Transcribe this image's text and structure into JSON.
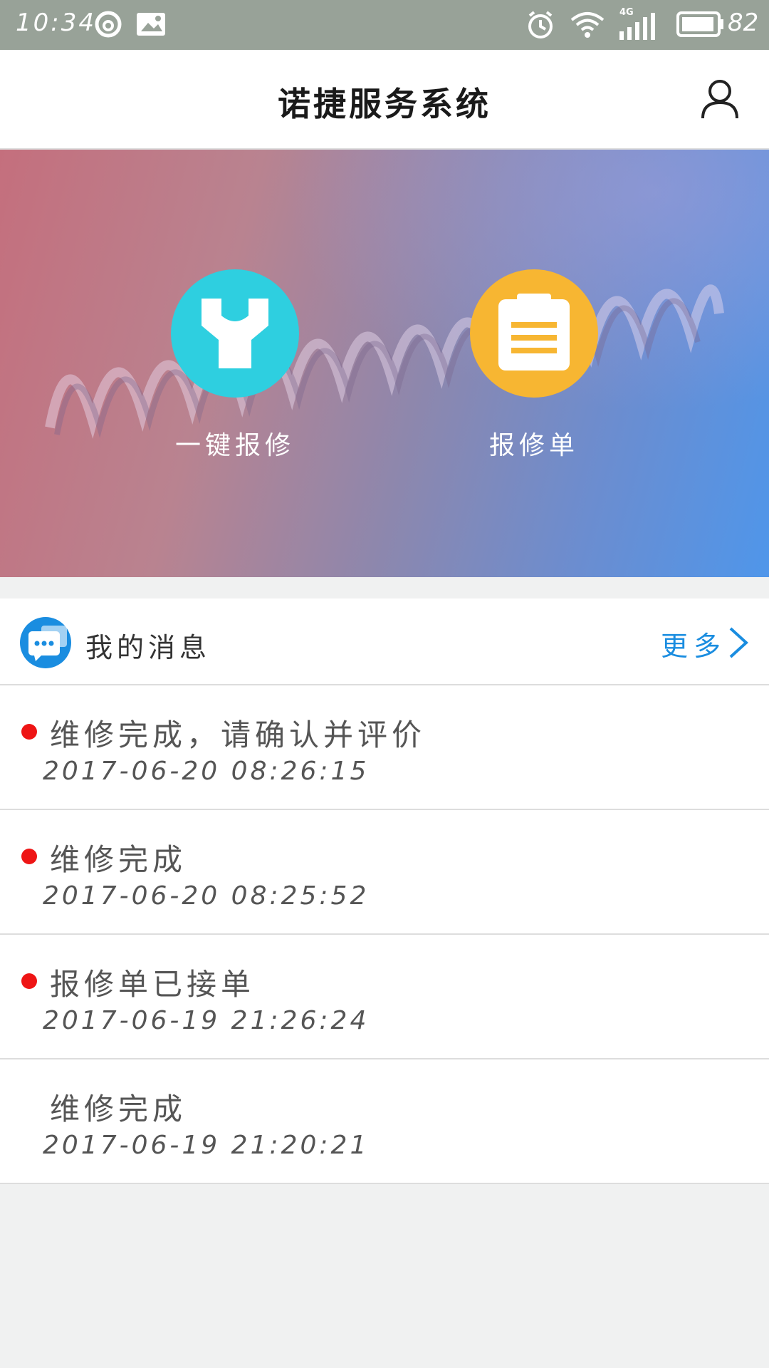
{
  "status_bar": {
    "time": "10:34",
    "network": "4G",
    "battery": "82",
    "icons": [
      "netease-icon",
      "image-icon",
      "alarm-icon",
      "wifi-icon",
      "signal-icon",
      "battery-icon"
    ]
  },
  "header": {
    "title": "诺捷服务系统",
    "profile_icon": "user-icon"
  },
  "banner": {
    "actions": [
      {
        "label": "一键报修",
        "icon": "wrench-icon",
        "color": "#2ecfe0"
      },
      {
        "label": "报修单",
        "icon": "clipboard-icon",
        "color": "#f7b632"
      }
    ]
  },
  "messages": {
    "title": "我的消息",
    "more_label": "更多",
    "accent": "#1a8de0",
    "items": [
      {
        "text": "维修完成，请确认并评价",
        "time": "2017-06-20 08:26:15",
        "unread": true
      },
      {
        "text": "维修完成",
        "time": "2017-06-20 08:25:52",
        "unread": true
      },
      {
        "text": "报修单已接单",
        "time": "2017-06-19 21:26:24",
        "unread": true
      },
      {
        "text": "维修完成",
        "time": "2017-06-19 21:20:21",
        "unread": false
      }
    ]
  }
}
